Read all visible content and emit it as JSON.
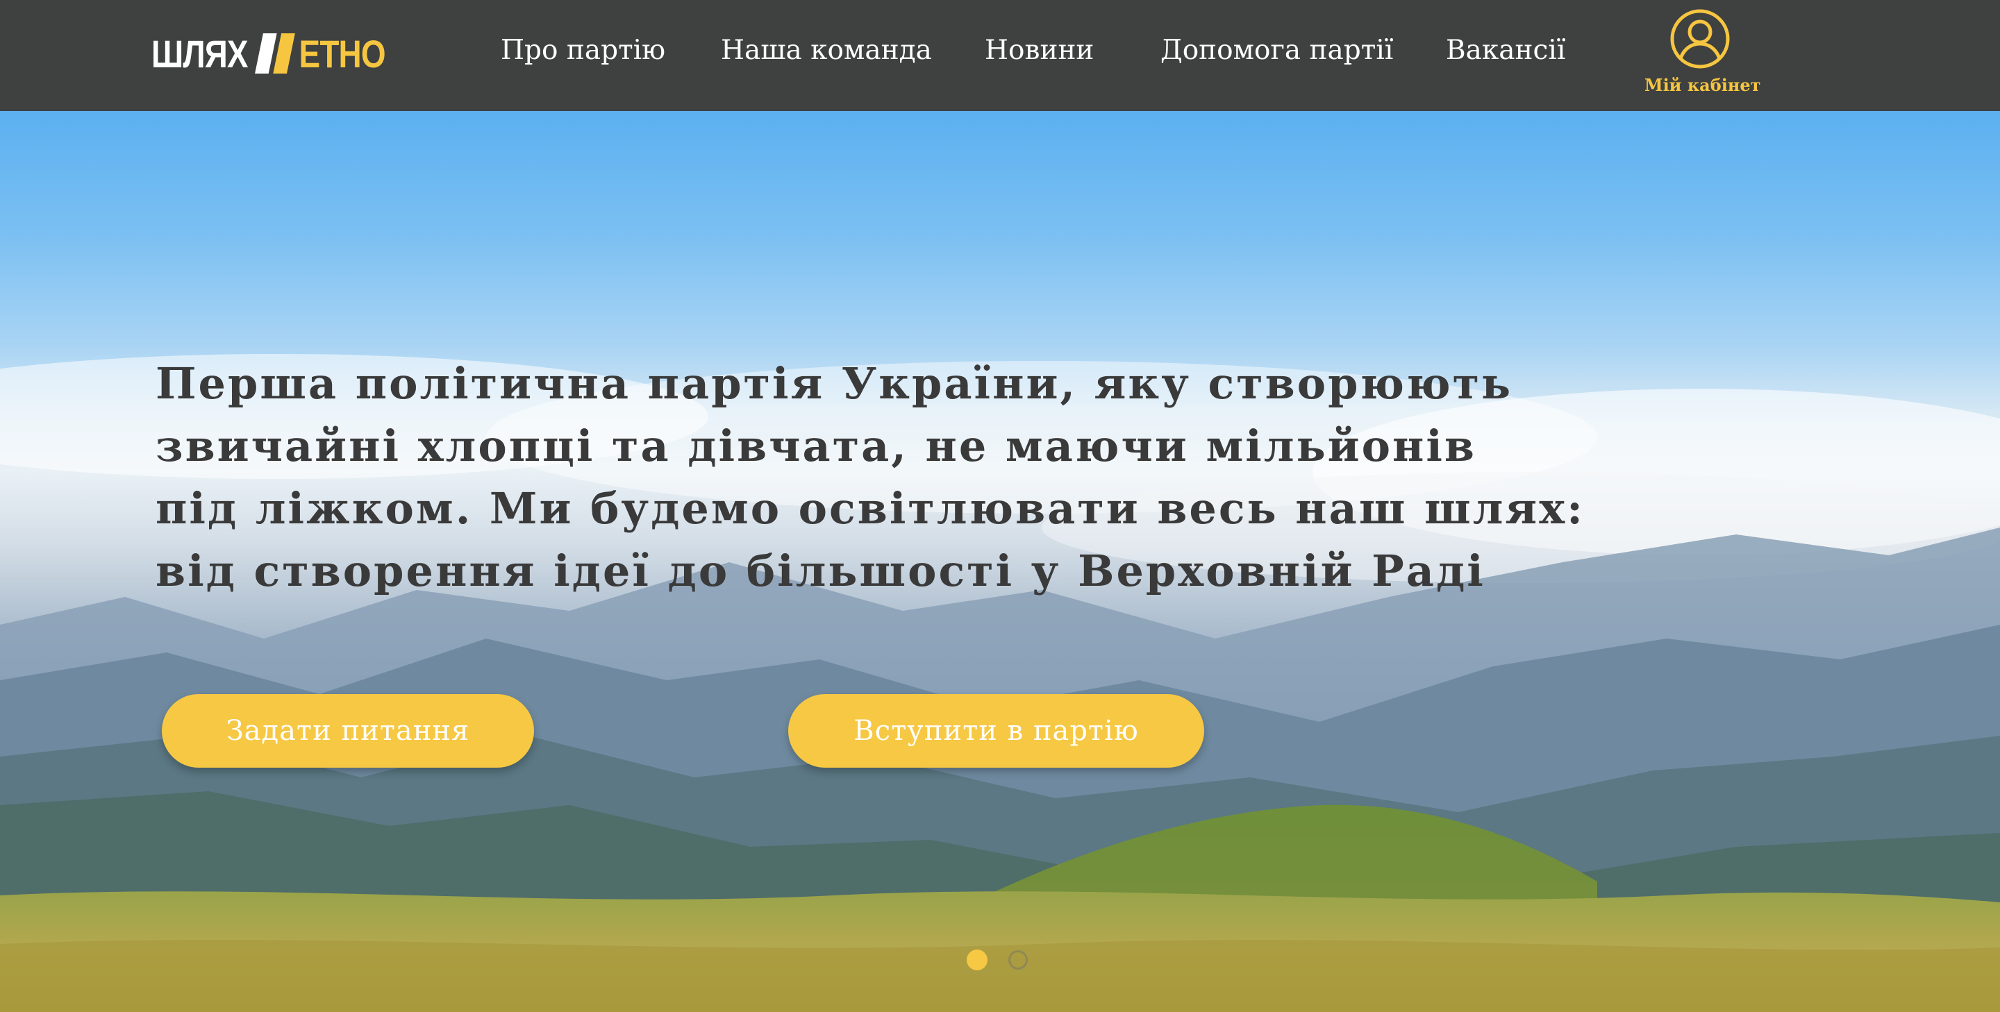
{
  "header": {
    "logo": {
      "part1": "ШЛЯХ",
      "part2": "ЕТНО"
    },
    "nav": [
      {
        "label": "Про партію"
      },
      {
        "label": "Наша команда"
      },
      {
        "label": "Новини"
      },
      {
        "label": "Допомога партії"
      },
      {
        "label": "Вакансії"
      }
    ],
    "cabinet": {
      "label": "Мій кабінет",
      "icon": "user-circle-icon"
    }
  },
  "hero": {
    "headline_lines": [
      "Перша політична партія України, яку створюють",
      "звичайні хлопці та дівчата, не маючи мільйонів",
      "під ліжком. Ми будемо освітлювати весь наш шлях:",
      "від створення ідеї до більшості у Верховній Раді"
    ],
    "buttons": {
      "ask": "Задати питання",
      "join": "Вступити в партію"
    },
    "slider": {
      "count": 2,
      "active": 1
    }
  },
  "colors": {
    "accent": "#f6c843",
    "header_bg": "#3f4040",
    "headline": "#3a3a3a"
  }
}
